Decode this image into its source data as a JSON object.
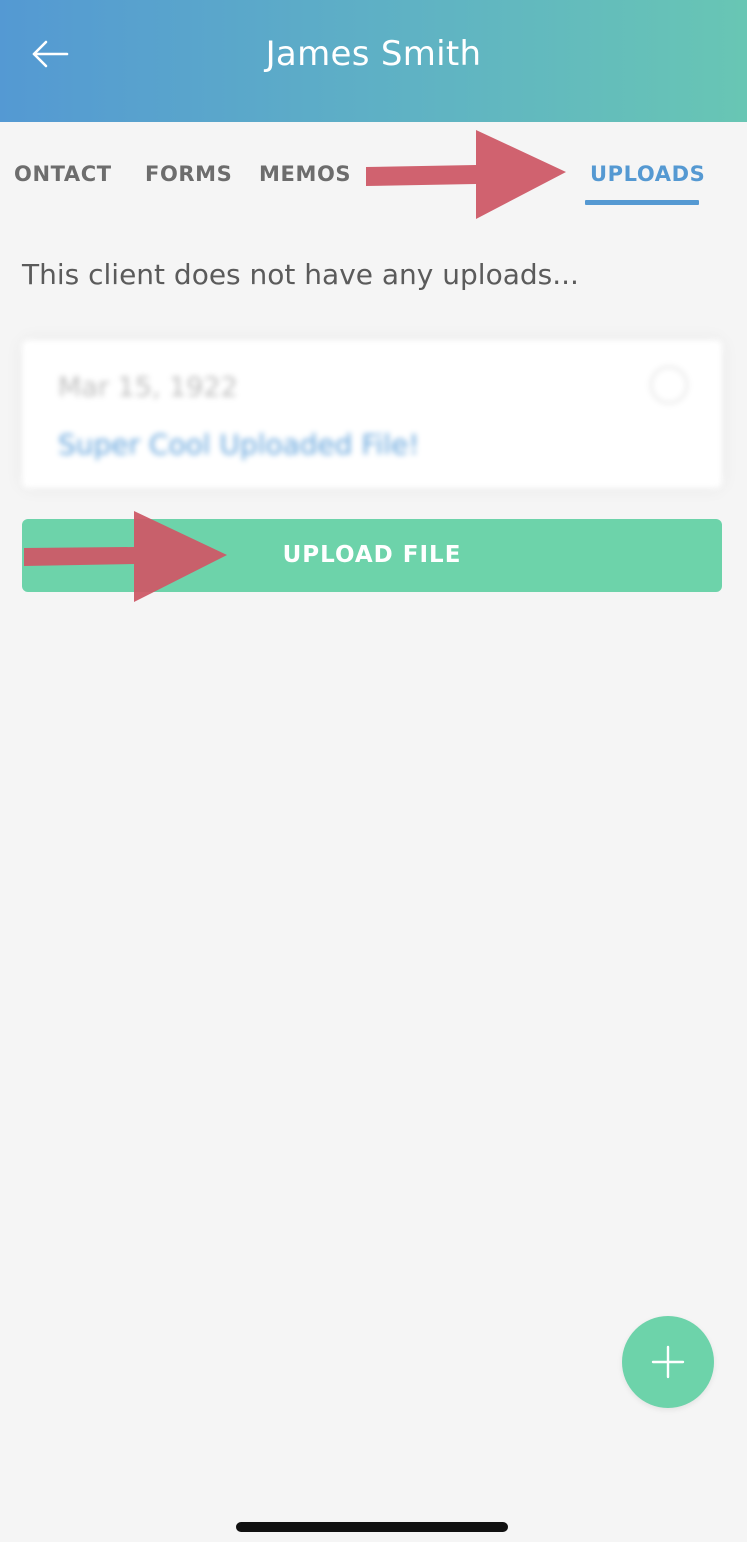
{
  "header": {
    "title": "James Smith",
    "back_icon": "arrow-left-icon",
    "background_gradient": [
      "#5499d3",
      "#68c6b4"
    ]
  },
  "tabs": [
    {
      "label": "ONTACT",
      "active": false
    },
    {
      "label": "FORMS",
      "active": false
    },
    {
      "label": "MEMOS",
      "active": false
    },
    {
      "label": "UPLOADS",
      "active": true
    }
  ],
  "uploads": {
    "empty_message": "This client does not have any uploads...",
    "sample_card": {
      "date": "Mar 15, 1922",
      "file_name": "Super Cool Uploaded File!",
      "info_icon": "info-circle-icon"
    },
    "upload_button_label": "UPLOAD FILE"
  },
  "fab": {
    "icon": "plus-icon"
  },
  "colors": {
    "accent_blue": "#5599d2",
    "accent_green": "#6dd3aa",
    "annotation_arrow": "#cd5a67",
    "background": "#f5f5f5"
  }
}
